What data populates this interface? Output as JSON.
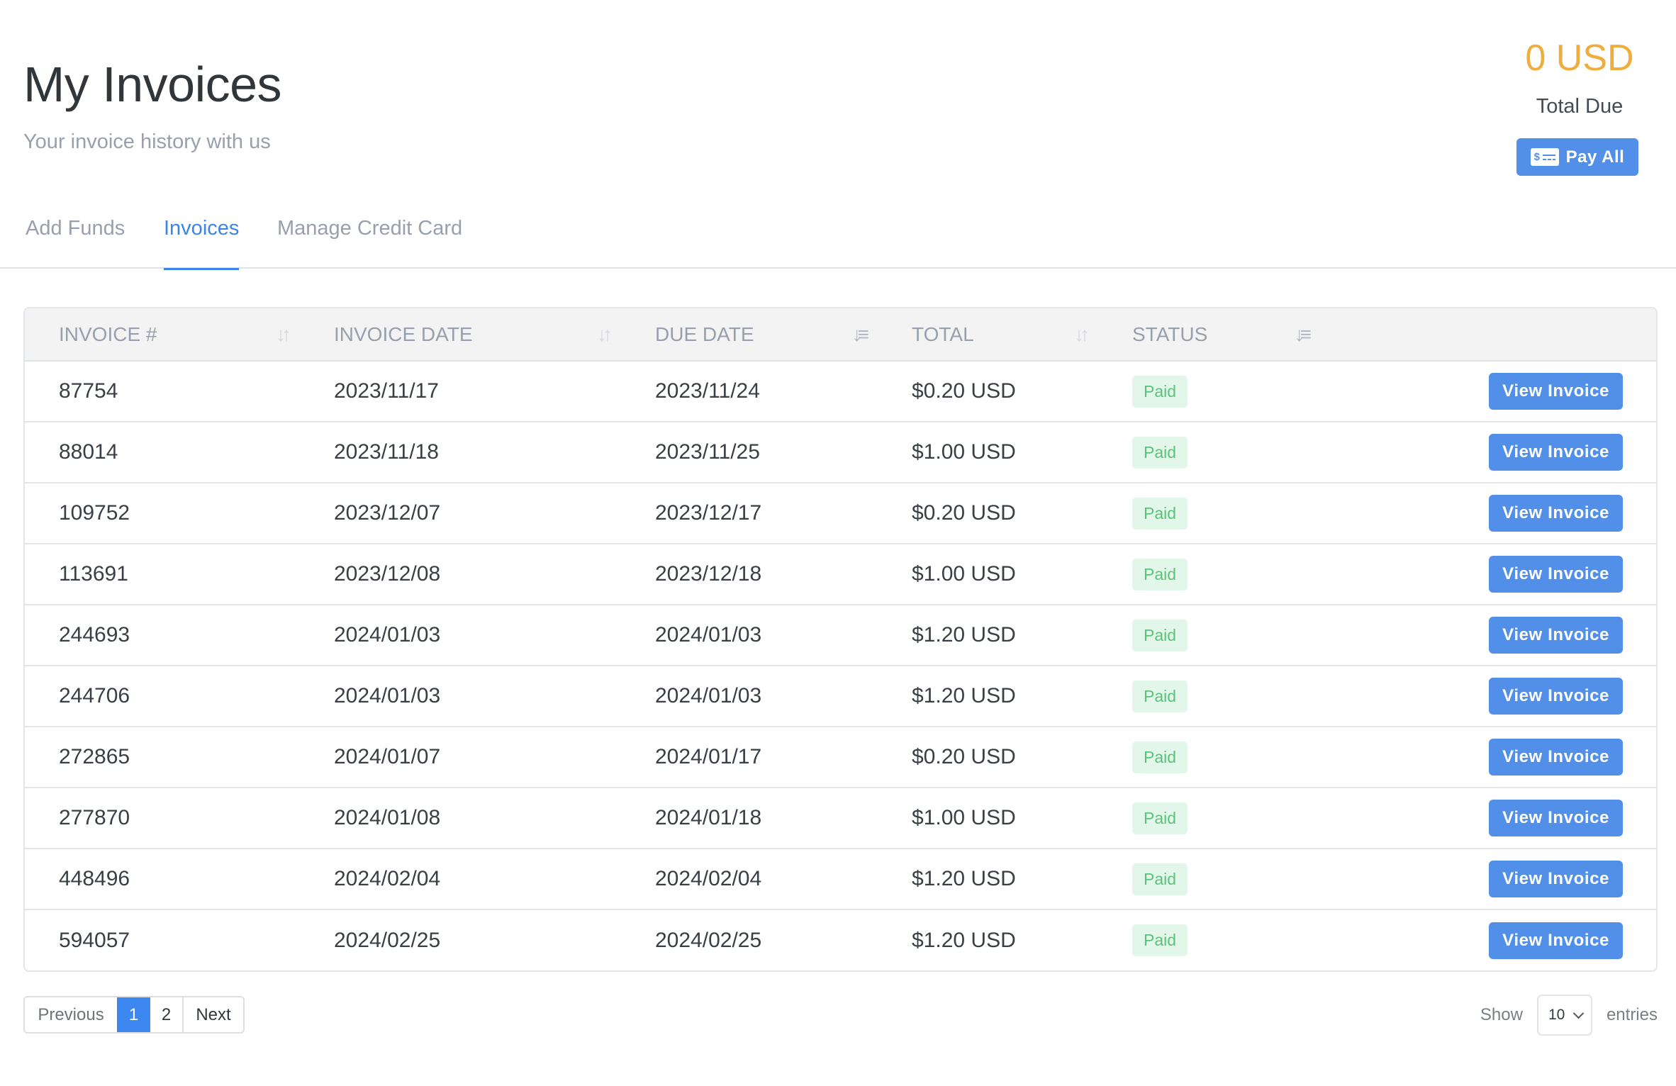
{
  "header": {
    "title": "My Invoices",
    "subtitle": "Your invoice history with us"
  },
  "summary": {
    "amount_due": "0 USD",
    "amount_label": "Total Due",
    "pay_all_label": "Pay All",
    "pay_icon": "payment-card-icon"
  },
  "tabs": [
    {
      "label": "Add Funds",
      "active": false
    },
    {
      "label": "Invoices",
      "active": true
    },
    {
      "label": "Manage Credit Card",
      "active": false
    }
  ],
  "table": {
    "columns": [
      {
        "label": "INVOICE #",
        "sort_icon": "sort-both-icon"
      },
      {
        "label": "INVOICE DATE",
        "sort_icon": "sort-both-icon"
      },
      {
        "label": "DUE DATE",
        "sort_icon": "sort-ascending-icon"
      },
      {
        "label": "TOTAL",
        "sort_icon": "sort-both-icon"
      },
      {
        "label": "STATUS",
        "sort_icon": "sort-descending-icon"
      },
      {
        "label": ""
      }
    ],
    "action_label": "View Invoice",
    "rows": [
      {
        "id": "87754",
        "invoice_date": "2023/11/17",
        "due_date": "2023/11/24",
        "total": "$0.20 USD",
        "status": "Paid"
      },
      {
        "id": "88014",
        "invoice_date": "2023/11/18",
        "due_date": "2023/11/25",
        "total": "$1.00 USD",
        "status": "Paid"
      },
      {
        "id": "109752",
        "invoice_date": "2023/12/07",
        "due_date": "2023/12/17",
        "total": "$0.20 USD",
        "status": "Paid"
      },
      {
        "id": "113691",
        "invoice_date": "2023/12/08",
        "due_date": "2023/12/18",
        "total": "$1.00 USD",
        "status": "Paid"
      },
      {
        "id": "244693",
        "invoice_date": "2024/01/03",
        "due_date": "2024/01/03",
        "total": "$1.20 USD",
        "status": "Paid"
      },
      {
        "id": "244706",
        "invoice_date": "2024/01/03",
        "due_date": "2024/01/03",
        "total": "$1.20 USD",
        "status": "Paid"
      },
      {
        "id": "272865",
        "invoice_date": "2024/01/07",
        "due_date": "2024/01/17",
        "total": "$0.20 USD",
        "status": "Paid"
      },
      {
        "id": "277870",
        "invoice_date": "2024/01/08",
        "due_date": "2024/01/18",
        "total": "$1.00 USD",
        "status": "Paid"
      },
      {
        "id": "448496",
        "invoice_date": "2024/02/04",
        "due_date": "2024/02/04",
        "total": "$1.20 USD",
        "status": "Paid"
      },
      {
        "id": "594057",
        "invoice_date": "2024/02/25",
        "due_date": "2024/02/25",
        "total": "$1.20 USD",
        "status": "Paid"
      }
    ]
  },
  "pagination": {
    "previous_label": "Previous",
    "pages": [
      "1",
      "2"
    ],
    "current_page": "1",
    "next_label": "Next"
  },
  "page_size": {
    "show_label": "Show",
    "value": "10",
    "entries_label": "entries"
  },
  "colors": {
    "accent": "#528fe9",
    "active_tab": "#3c85e6",
    "amount_due": "#f0ad3c",
    "paid_badge_bg": "#e2f6ea",
    "paid_badge_text": "#5cc27a"
  }
}
